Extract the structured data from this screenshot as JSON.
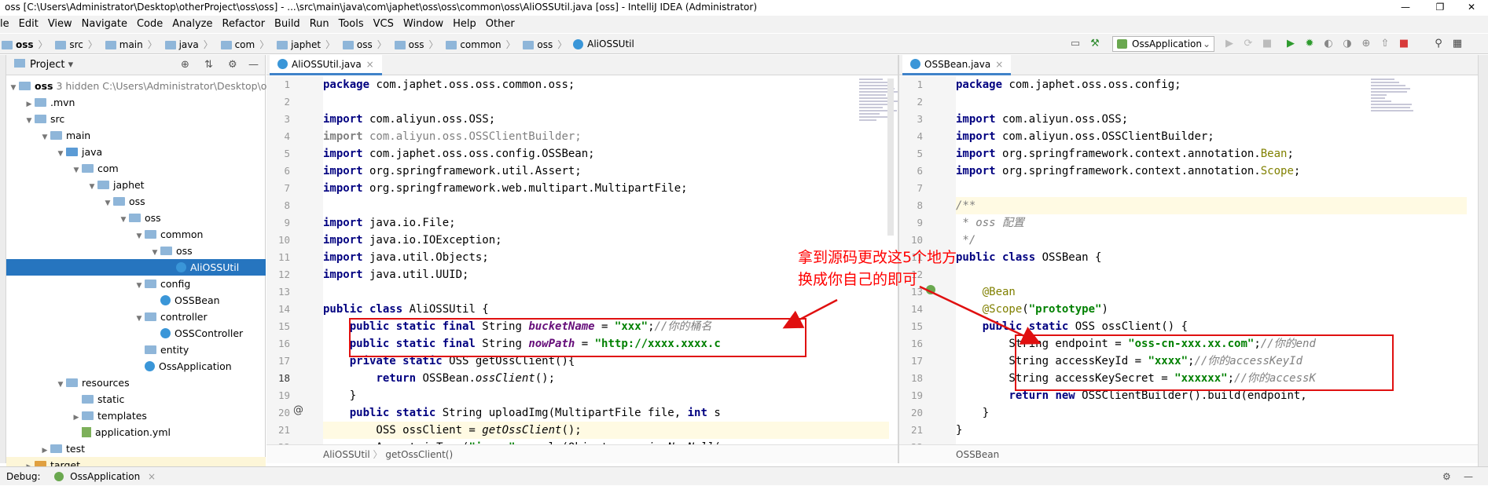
{
  "window": {
    "title": "oss [C:\\Users\\Administrator\\Desktop\\otherProject\\oss\\oss] - ...\\src\\main\\java\\com\\japhet\\oss\\oss\\common\\oss\\AliOSSUtil.java [oss] - IntelliJ IDEA (Administrator)",
    "minimize": "—",
    "restore": "❐",
    "close": "✕"
  },
  "menu": [
    "le",
    "Edit",
    "View",
    "Navigate",
    "Code",
    "Analyze",
    "Refactor",
    "Build",
    "Run",
    "Tools",
    "VCS",
    "Window",
    "Help",
    "Other"
  ],
  "breadcrumbs": [
    "oss",
    "src",
    "main",
    "java",
    "com",
    "japhet",
    "oss",
    "oss",
    "common",
    "oss",
    "AliOSSUtil"
  ],
  "toolbar": {
    "run_config": "OssApplication"
  },
  "project": {
    "header": "Project",
    "rows": [
      {
        "label": "oss",
        "extra": "3 hidden  C:\\Users\\Administrator\\Desktop\\othe"
      },
      {
        "label": ".mvn"
      },
      {
        "label": "src"
      },
      {
        "label": "main"
      },
      {
        "label": "java"
      },
      {
        "label": "com"
      },
      {
        "label": "japhet"
      },
      {
        "label": "oss"
      },
      {
        "label": "oss"
      },
      {
        "label": "common"
      },
      {
        "label": "oss"
      },
      {
        "label": "AliOSSUtil"
      },
      {
        "label": "config"
      },
      {
        "label": "OSSBean"
      },
      {
        "label": "controller"
      },
      {
        "label": "OSSController"
      },
      {
        "label": "entity"
      },
      {
        "label": "OssApplication"
      },
      {
        "label": "resources"
      },
      {
        "label": "static"
      },
      {
        "label": "templates"
      },
      {
        "label": "application.yml"
      },
      {
        "label": "test"
      },
      {
        "label": "target"
      }
    ]
  },
  "left_editor": {
    "tab": "AliOSSUtil.java",
    "close": "×",
    "line_numbers": [
      "1",
      "2",
      "3",
      "4",
      "5",
      "6",
      "7",
      "8",
      "9",
      "10",
      "11",
      "12",
      "13",
      "14",
      "15",
      "16",
      "17",
      "18",
      "19",
      "20",
      "21",
      "22"
    ],
    "breadcrumb": [
      "AliOSSUtil",
      "getOssClient()"
    ]
  },
  "right_editor": {
    "tab": "OSSBean.java",
    "close": "×",
    "line_numbers": [
      "1",
      "2",
      "3",
      "4",
      "5",
      "6",
      "7",
      "8",
      "9",
      "10",
      "11",
      "12",
      "13",
      "14",
      "15",
      "16",
      "17",
      "18",
      "19",
      "20",
      "21",
      "22"
    ],
    "breadcrumb": [
      "OSSBean"
    ]
  },
  "callout": {
    "line1": "拿到源码更改这5个地方",
    "line2": "换成你自己的即可",
    "color": "#ff0000"
  },
  "debug": {
    "label": "Debug:",
    "session": "OssApplication"
  }
}
